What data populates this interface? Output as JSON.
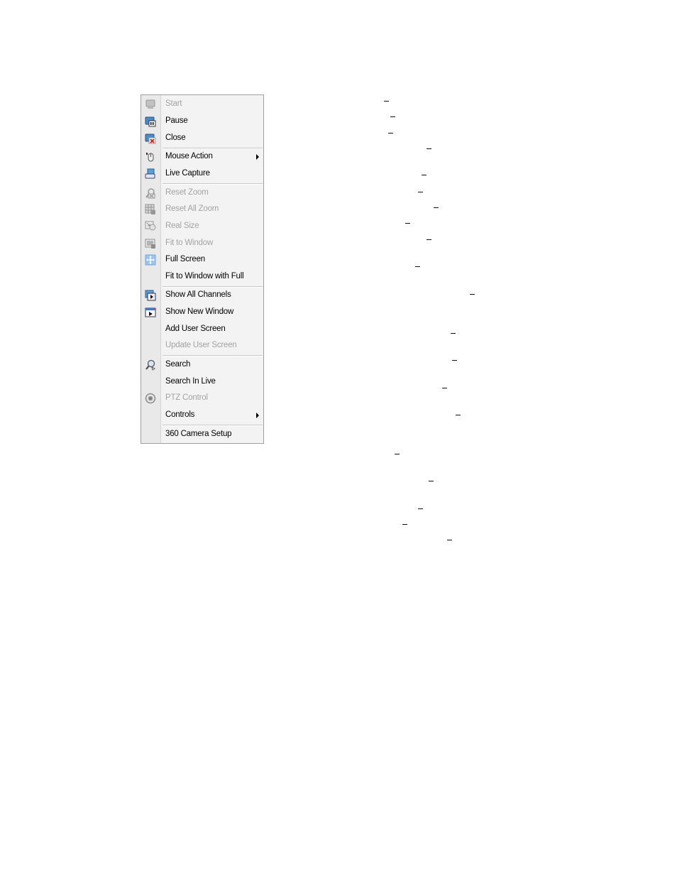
{
  "context_menu": {
    "items": [
      {
        "label": "Start",
        "icon": "monitor-icon",
        "enabled": false
      },
      {
        "label": "Pause",
        "icon": "pause-monitor-icon",
        "enabled": true
      },
      {
        "label": "Close",
        "icon": "close-monitor-icon",
        "enabled": true
      },
      {
        "label": "Mouse Action",
        "icon": "mouse-icon",
        "enabled": true,
        "submenu": true
      },
      {
        "label": "Live Capture",
        "icon": "capture-icon",
        "enabled": true
      },
      {
        "label": "Reset Zoom",
        "icon": "reset-zoom-icon",
        "enabled": false
      },
      {
        "label": "Reset All Zoom",
        "icon": "reset-all-zoom-icon",
        "enabled": false
      },
      {
        "label": "Real Size",
        "icon": "real-size-icon",
        "enabled": false
      },
      {
        "label": "Fit to Window",
        "icon": "fit-window-icon",
        "enabled": false
      },
      {
        "label": "Full Screen",
        "icon": "full-screen-icon",
        "enabled": true
      },
      {
        "label": "Fit to Window with Full",
        "icon": "",
        "enabled": true
      },
      {
        "label": "Show All Channels",
        "icon": "show-channels-icon",
        "enabled": true
      },
      {
        "label": "Show New Window",
        "icon": "new-window-icon",
        "enabled": true
      },
      {
        "label": "Add User Screen",
        "icon": "",
        "enabled": true
      },
      {
        "label": "Update User Screen",
        "icon": "",
        "enabled": false
      },
      {
        "label": "Search",
        "icon": "search-icon",
        "enabled": true
      },
      {
        "label": "Search In Live",
        "icon": "",
        "enabled": true
      },
      {
        "label": "PTZ Control",
        "icon": "ptz-icon",
        "enabled": false
      },
      {
        "label": "Controls",
        "icon": "",
        "enabled": true,
        "submenu": true
      },
      {
        "label": "360 Camera Setup",
        "icon": "",
        "enabled": true
      }
    ]
  },
  "colors": {
    "menu_bg": "#f3f3f3",
    "gutter_bg": "#e9e9e9",
    "disabled_text": "#a3a3a3",
    "border": "#a0a0a0"
  }
}
